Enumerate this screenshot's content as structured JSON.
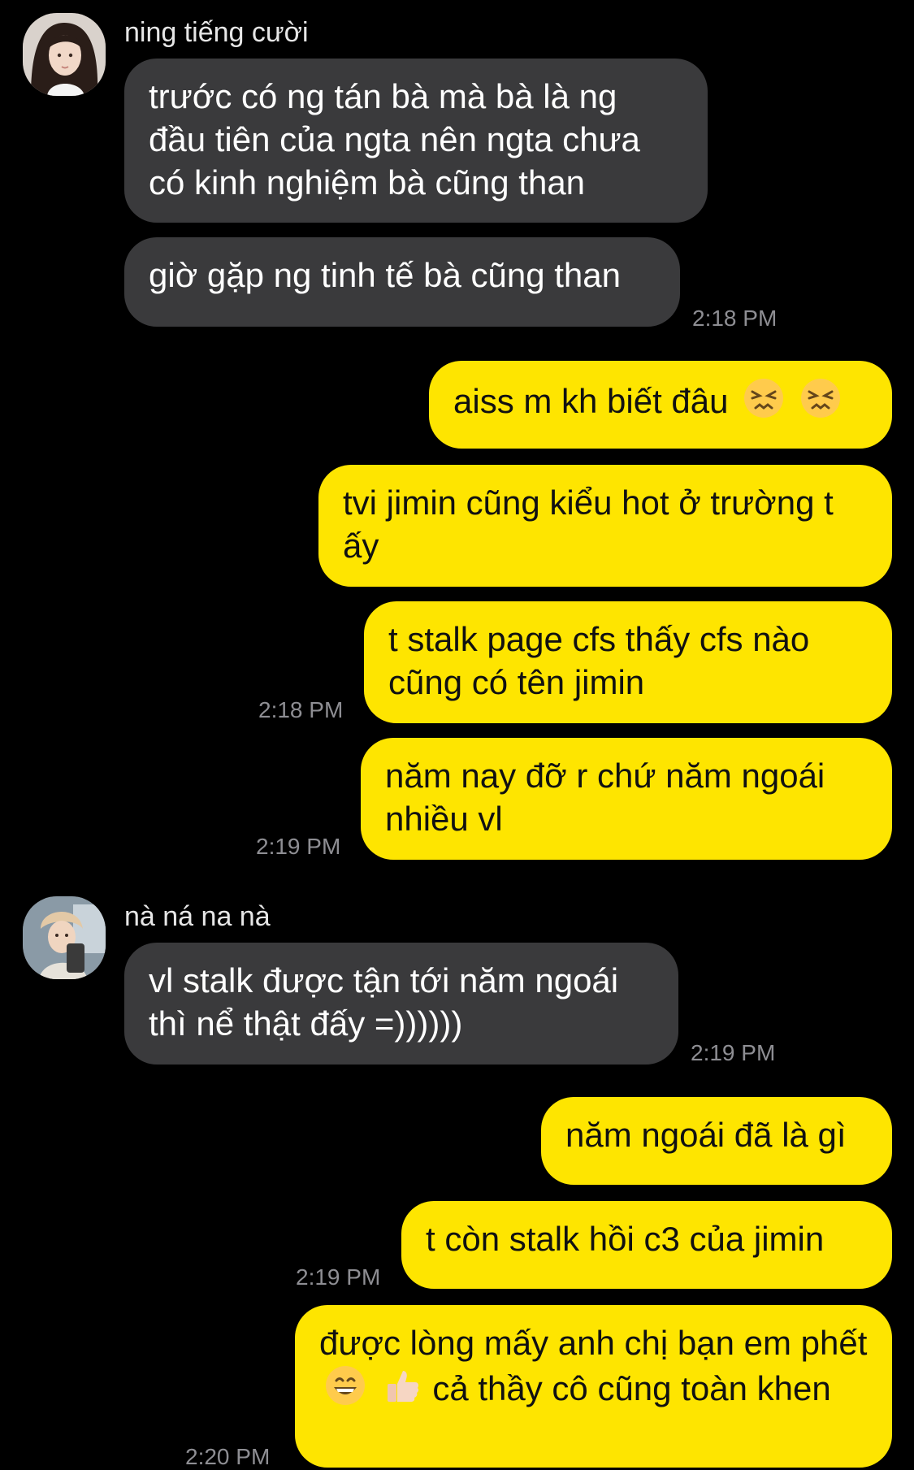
{
  "conversation": {
    "group1": {
      "sender": "ning tiếng cười",
      "messages": [
        "trước có ng tán bà mà bà là ng đầu tiên của ngta nên ngta chưa có kinh nghiệm bà cũng than",
        "giờ gặp ng tinh tế bà cũng than"
      ],
      "time": "2:18 PM"
    },
    "me1": {
      "messages": [
        "aiss m kh biết đâu",
        "tvi jimin cũng kiểu hot ở trường t ấy",
        "t stalk page cfs thấy cfs nào cũng có tên jimin",
        "năm nay đỡ r chứ năm ngoái nhiều vl"
      ],
      "emojis_msg1": [
        "persevering-face-emoji",
        "persevering-face-emoji"
      ],
      "time_a": "2:18 PM",
      "time_b": "2:19 PM"
    },
    "group2": {
      "sender": "nà ná na nà",
      "messages": [
        "vl stalk được tận tới năm ngoái thì nể thật đấy =))))))"
      ],
      "time": "2:19 PM"
    },
    "me2": {
      "messages": [
        "năm ngoái đã là gì",
        "t còn stalk hồi c3 của jimin",
        "được lòng mấy anh chị bạn em phết",
        "cả thầy cô cũng toàn khen"
      ],
      "emojis_msg3": [
        "grinning-face-emoji",
        "thumbs-up-emoji"
      ],
      "time_a": "2:19 PM",
      "time_b": "2:20 PM"
    },
    "colors": {
      "background": "#000000",
      "incoming_bubble": "#3a3a3c",
      "outgoing_bubble": "#fee500",
      "timestamp": "#8e8e93"
    }
  }
}
